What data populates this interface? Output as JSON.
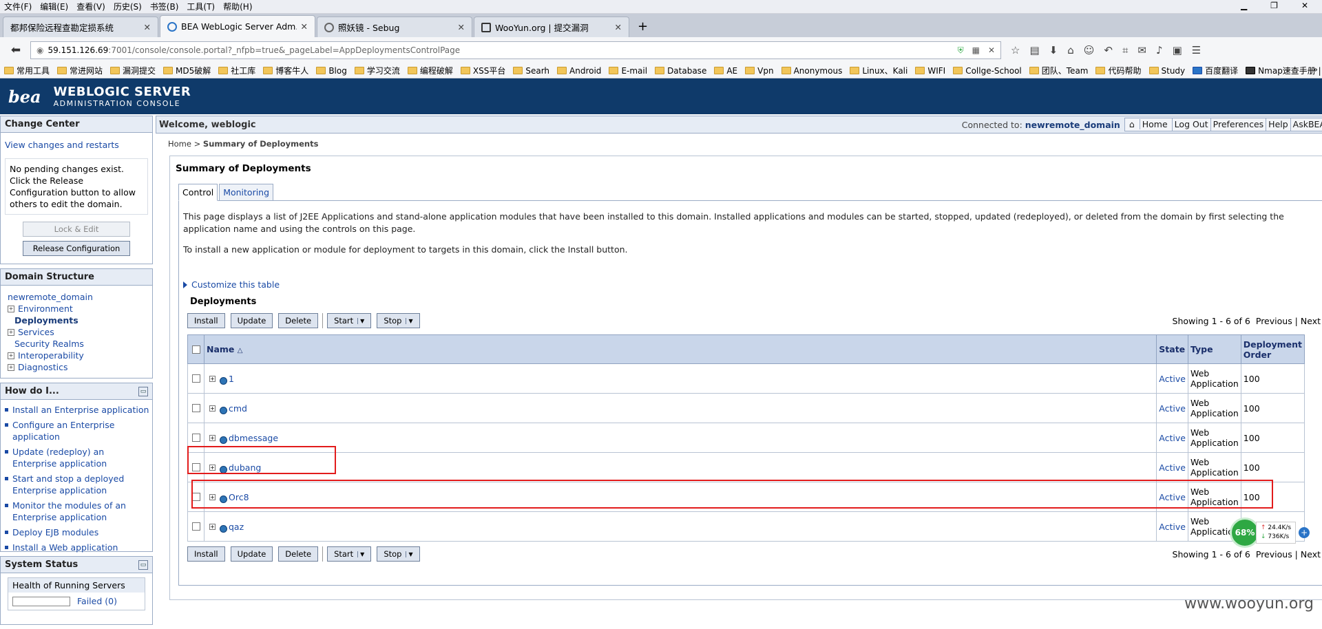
{
  "browser": {
    "menu": [
      "文件(F)",
      "编辑(E)",
      "查看(V)",
      "历史(S)",
      "书签(B)",
      "工具(T)",
      "帮助(H)"
    ],
    "tabs": [
      {
        "label": "都邦保险远程查勘定损系统"
      },
      {
        "label": "BEA WebLogic Server Adm..."
      },
      {
        "label": "照妖镜 - Sebug"
      },
      {
        "label": "WooYun.org | 提交漏洞"
      }
    ],
    "url_host": "59.151.126.69",
    "url_rest": ":7001/console/console.portal?_nfpb=true&_pageLabel=AppDeploymentsControlPage",
    "bookmarks": [
      "常用工具",
      "常进网站",
      "漏洞提交",
      "MD5破解",
      "社工库",
      "博客牛人",
      "Blog",
      "学习交流",
      "编程破解",
      "XSS平台",
      "Searh",
      "Android",
      "E-mail",
      "Database",
      "AE",
      "Vpn",
      "Anonymous",
      "Linux、Kali",
      "WIFI",
      "Collge-School",
      "团队、Team",
      "代码帮助",
      "Study",
      "百度翻译",
      "Nmap速查手册 | Woo..."
    ]
  },
  "header": {
    "logo": "bea",
    "title": "WEBLOGIC SERVER",
    "subtitle": "ADMINISTRATION CONSOLE"
  },
  "change_center": {
    "title": "Change Center",
    "view_link": "View changes and restarts",
    "note": "No pending changes exist. Click the Release Configuration button to allow others to edit the domain.",
    "lock_btn": "Lock & Edit",
    "release_btn": "Release Configuration"
  },
  "domain_structure": {
    "title": "Domain Structure",
    "root": "newremote_domain",
    "items": [
      "Environment",
      "Deployments",
      "Services",
      "Security Realms",
      "Interoperability",
      "Diagnostics"
    ]
  },
  "how_do_i": {
    "title": "How do I...",
    "items": [
      "Install an Enterprise application",
      "Configure an Enterprise application",
      "Update (redeploy) an Enterprise application",
      "Start and stop a deployed Enterprise application",
      "Monitor the modules of an Enterprise application",
      "Deploy EJB modules",
      "Install a Web application"
    ]
  },
  "system_status": {
    "title": "System Status",
    "health": "Health of Running Servers",
    "failed": "Failed (0)"
  },
  "topbar": {
    "welcome": "Welcome, weblogic",
    "connected_label": "Connected to:",
    "domain": "newremote_domain",
    "links": [
      "Home",
      "Log Out",
      "Preferences",
      "Help",
      "AskBEA"
    ]
  },
  "breadcrumb": {
    "home": "Home",
    "sep": ">",
    "current": "Summary of Deployments"
  },
  "summary": {
    "title": "Summary of Deployments",
    "tabs": [
      "Control",
      "Monitoring"
    ],
    "desc1": "This page displays a list of J2EE Applications and stand-alone application modules that have been installed to this domain. Installed applications and modules can be started, stopped, updated (redeployed), or deleted from the domain by first selecting the application name and using the controls on this page.",
    "desc2": "To install a new application or module for deployment to targets in this domain, click the Install button.",
    "customize": "Customize this table",
    "table_title": "Deployments",
    "buttons": {
      "install": "Install",
      "update": "Update",
      "delete": "Delete",
      "start": "Start",
      "stop": "Stop"
    },
    "showing": "Showing 1 - 6 of 6",
    "previous": "Previous",
    "next": "Next",
    "columns": {
      "name": "Name",
      "state": "State",
      "type": "Type",
      "order": "Deployment Order"
    },
    "rows": [
      {
        "name": "1",
        "state": "Active",
        "type": "Web Application",
        "order": "100"
      },
      {
        "name": "cmd",
        "state": "Active",
        "type": "Web Application",
        "order": "100"
      },
      {
        "name": "dbmessage",
        "state": "Active",
        "type": "Web Application",
        "order": "100"
      },
      {
        "name": "dubang",
        "state": "Active",
        "type": "Web Application",
        "order": "100"
      },
      {
        "name": "Orc8",
        "state": "Active",
        "type": "Web Application",
        "order": "100"
      },
      {
        "name": "qaz",
        "state": "Active",
        "type": "Web Application",
        "order": "100"
      }
    ]
  },
  "net_widget": {
    "percent": "68%",
    "up": "24.4K/s",
    "down": "736K/s"
  },
  "watermark": "www.wooyun.org"
}
